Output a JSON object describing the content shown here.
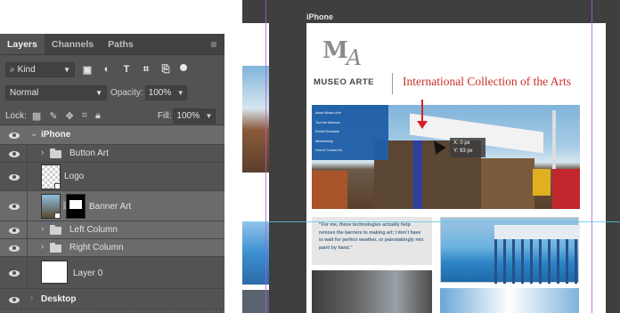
{
  "layers_panel": {
    "tabs": [
      {
        "label": "Layers",
        "active": true
      },
      {
        "label": "Channels",
        "active": false
      },
      {
        "label": "Paths",
        "active": false
      }
    ],
    "menu_icon": "panel-menu-icon",
    "filter": {
      "kind_label": "Kind",
      "icons": [
        "image-filter-icon",
        "adjustment-filter-icon",
        "type-filter-icon",
        "shape-filter-icon",
        "smart-object-filter-icon",
        "filter-toggle-icon"
      ]
    },
    "blend_mode": "Normal",
    "opacity_label": "Opacity:",
    "opacity_value": "100%",
    "lock_label": "Lock:",
    "lock_icons": [
      "lock-transparent-icon",
      "lock-paint-icon",
      "lock-position-icon",
      "lock-artboard-icon",
      "lock-all-icon"
    ],
    "fill_label": "Fill:",
    "fill_value": "100%",
    "layers": [
      {
        "name": "iPhone",
        "type": "artboard",
        "expanded": true,
        "visible": true
      },
      {
        "name": "Button Art",
        "type": "group",
        "expanded": false,
        "visible": true
      },
      {
        "name": "Logo",
        "type": "smart-object",
        "visible": true
      },
      {
        "name": "Banner Art",
        "type": "smart-object-masked",
        "visible": true,
        "selected": true
      },
      {
        "name": "Left Column",
        "type": "group",
        "expanded": false,
        "visible": true
      },
      {
        "name": "Right Column",
        "type": "group",
        "expanded": false,
        "visible": true
      },
      {
        "name": "Layer 0",
        "type": "layer",
        "visible": true
      },
      {
        "name": "Desktop",
        "type": "artboard",
        "expanded": false,
        "visible": true
      }
    ]
  },
  "document": {
    "artboard_label": "iPhone",
    "logo_letters": "M",
    "logo_script": "A",
    "logo_text": "MUSEO ARTE",
    "site_title": "International Collection of the Arts",
    "nav_items": [
      "About Museo Arte",
      "Tour the Museum",
      "Exhibit Schedule",
      "Membership",
      "How to Contact Us"
    ],
    "measure_x": "X:  0 px",
    "measure_y": "Y: 93 px",
    "quote": "“For me, these technologies actually help remove the barriers to making art; I don’t have to wait for perfect weather, or painstakingly mix paint by hand.”",
    "colors": {
      "title_red": "#c9302c",
      "nav_blue": "#1f5fa8",
      "quote_blue": "#4b6b86"
    }
  }
}
